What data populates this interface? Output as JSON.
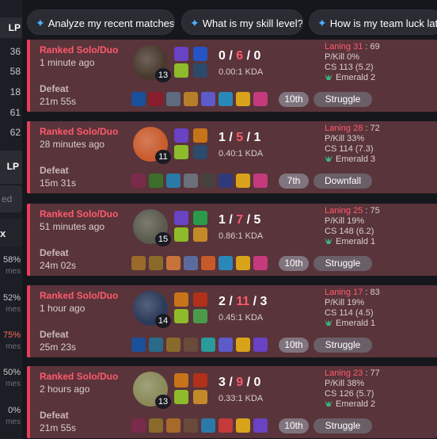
{
  "sidebar": {
    "lp_header": "LP",
    "lp_values": [
      "36",
      "58",
      "18",
      "61",
      "62"
    ],
    "search_placeholder": "ed",
    "x_label": "x",
    "winrates": [
      {
        "pct": "58%",
        "sub": "mes"
      },
      {
        "pct": "52%",
        "sub": "mes"
      },
      {
        "pct": "75%",
        "sub": "mes"
      },
      {
        "pct": "50%",
        "sub": "mes"
      },
      {
        "pct": "0%",
        "sub": "mes"
      }
    ]
  },
  "prompts": [
    {
      "label": "Analyze my recent matches.",
      "icon": "sparkle-icon"
    },
    {
      "label": "What is my skill level?",
      "icon": "sparkle-icon"
    },
    {
      "label": "How is my team luck latel",
      "icon": "sparkle-icon"
    }
  ],
  "matches": [
    {
      "queue": "Ranked Solo/Duo",
      "time": "1 minute ago",
      "result": "Defeat",
      "duration": "21m 55s",
      "champ_level": "13",
      "k": "0",
      "d": "6",
      "a": "0",
      "kda": "0.00:1 KDA",
      "place": "10th",
      "tag": "Struggle",
      "laning": "Laning 31",
      "laning_score": "69",
      "pkill": "P/Kill 0%",
      "cs": "CS 113 (5.2)",
      "rank": "Emerald 2",
      "champ_color": "#4a3a2e",
      "spells": [
        "#6a42c4",
        "#2554c7",
        "#8dbb2b",
        "#2d4a6a"
      ],
      "items": [
        "#1a4f9a",
        "#8a1d2b",
        "#5c6b7e",
        "#b77e2a",
        "#5d5ac9",
        "#2a88b8",
        "#d8a31a",
        "#c43a7c"
      ]
    },
    {
      "queue": "Ranked Solo/Duo",
      "time": "28 minutes ago",
      "result": "Defeat",
      "duration": "15m 31s",
      "champ_level": "11",
      "k": "1",
      "d": "5",
      "a": "1",
      "kda": "0.40:1 KDA",
      "place": "7th",
      "tag": "Downfall",
      "laning": "Laning 28",
      "laning_score": "72",
      "pkill": "P/Kill 33%",
      "cs": "CS 114 (7.3)",
      "rank": "Emerald 3",
      "champ_color": "#c95c2e",
      "spells": [
        "#6a42c4",
        "#c7731a",
        "#8dbb2b",
        "#2d4a6a"
      ],
      "items": [
        "#7a2a4a",
        "#3b6e2a",
        "#2a7aa8",
        "#6a6f79",
        "#46413f",
        "#2f3a7a",
        "#d8a31a",
        "#c43a7c"
      ]
    },
    {
      "queue": "Ranked Solo/Duo",
      "time": "51 minutes ago",
      "result": "Defeat",
      "duration": "24m 02s",
      "champ_level": "15",
      "k": "1",
      "d": "7",
      "a": "5",
      "kda": "0.86:1 KDA",
      "place": "10th",
      "tag": "Struggle",
      "laning": "Laning 25",
      "laning_score": "75",
      "pkill": "P/Kill 19%",
      "cs": "CS 148 (6.2)",
      "rank": "Emerald 1",
      "champ_color": "#5a5a4e",
      "spells": [
        "#6a42c4",
        "#2a9a4a",
        "#8dbb2b",
        "#c48a2a"
      ],
      "items": [
        "#9a6a2a",
        "#8a6a2a",
        "#c7733a",
        "#5c6b9e",
        "#c85a2a",
        "#2a88b8",
        "#d8a31a",
        "#c43a7c"
      ]
    },
    {
      "queue": "Ranked Solo/Duo",
      "time": "1 hour ago",
      "result": "Defeat",
      "duration": "25m 23s",
      "champ_level": "14",
      "k": "2",
      "d": "11",
      "a": "3",
      "kda": "0.45:1 KDA",
      "place": "10th",
      "tag": "Struggle",
      "laning": "Laning 17",
      "laning_score": "83",
      "pkill": "P/Kill 19%",
      "cs": "CS 114 (4.5)",
      "rank": "Emerald 1",
      "champ_color": "#2c3a5a",
      "spells": [
        "#c7731a",
        "#b0301a",
        "#8dbb2b",
        "#4a9a4a"
      ],
      "items": [
        "#1a4f9a",
        "#2a6a8a",
        "#8a6a2a",
        "#6a4a3a",
        "#2a9a9a",
        "#5d5ac9",
        "#d8a31a",
        "#6a42c4"
      ]
    },
    {
      "queue": "Ranked Solo/Duo",
      "time": "2 hours ago",
      "result": "Defeat",
      "duration": "21m 55s",
      "champ_level": "13",
      "k": "3",
      "d": "9",
      "a": "0",
      "kda": "0.33:1 KDA",
      "place": "10th",
      "tag": "Struggle",
      "laning": "Laning 23",
      "laning_score": "77",
      "pkill": "P/Kill 38%",
      "cs": "CS 126 (5.7)",
      "rank": "Emerald 2",
      "champ_color": "#8a8a5a",
      "spells": [
        "#c7731a",
        "#b0301a",
        "#8dbb2b",
        "#c48a2a"
      ],
      "items": [
        "#7a2a4a",
        "#8a6a2a",
        "#a86a2a",
        "#6a4a3a",
        "#2a7aa8",
        "#c43a3a",
        "#d8a31a",
        "#6a42c4"
      ]
    }
  ]
}
